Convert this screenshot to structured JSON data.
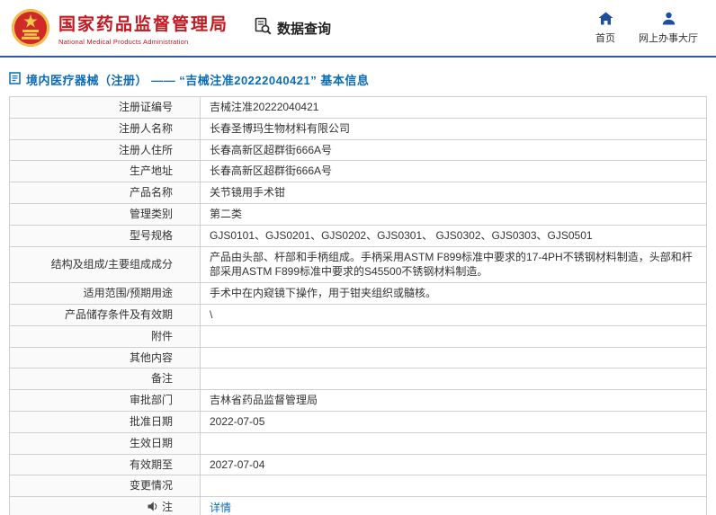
{
  "colors": {
    "brand_red": "#c0191f",
    "header_divider_blue": "#2b5aa7",
    "link_blue": "#0a6cb6",
    "nav_icon_blue": "#1e4f9f"
  },
  "header": {
    "agency_cn": "国家药品监督管理局",
    "agency_en": "National Medical Products Administration",
    "data_query": "数据查询",
    "nav_home": "首页",
    "nav_hall": "网上办事大厅"
  },
  "page": {
    "title": "境内医疗器械（注册） —— “吉械注准20222040421” 基本信息"
  },
  "table": {
    "rows": [
      {
        "label": "注册证编号",
        "value": "吉械注准20222040421"
      },
      {
        "label": "注册人名称",
        "value": "长春圣博玛生物材料有限公司"
      },
      {
        "label": "注册人住所",
        "value": "长春高新区超群街666A号"
      },
      {
        "label": "生产地址",
        "value": "长春高新区超群街666A号"
      },
      {
        "label": "产品名称",
        "value": "关节镜用手术钳"
      },
      {
        "label": "管理类别",
        "value": "第二类"
      },
      {
        "label": "型号规格",
        "value": "GJS0101、GJS0201、GJS0202、GJS0301、 GJS0302、GJS0303、GJS0501"
      },
      {
        "label": "结构及组成/主要组成成分",
        "value": "产品由头部、杆部和手柄组成。手柄采用ASTM F899标准中要求的17-4PH不锈钢材料制造，头部和杆部采用ASTM F899标准中要求的S45500不锈钢材料制造。"
      },
      {
        "label": "适用范围/预期用途",
        "value": "手术中在内窥镜下操作，用于钳夹组织或髓核。"
      },
      {
        "label": "产品储存条件及有效期",
        "value": "\\"
      },
      {
        "label": "附件",
        "value": ""
      },
      {
        "label": "其他内容",
        "value": ""
      },
      {
        "label": "备注",
        "value": ""
      },
      {
        "label": "审批部门",
        "value": "吉林省药品监督管理局"
      },
      {
        "label": "批准日期",
        "value": "2022-07-05"
      },
      {
        "label": "生效日期",
        "value": ""
      },
      {
        "label": "有效期至",
        "value": "2027-07-04"
      },
      {
        "label": "变更情况",
        "value": ""
      },
      {
        "label": "注",
        "icon": "speaker-icon",
        "value": "详情",
        "link": true
      }
    ]
  }
}
